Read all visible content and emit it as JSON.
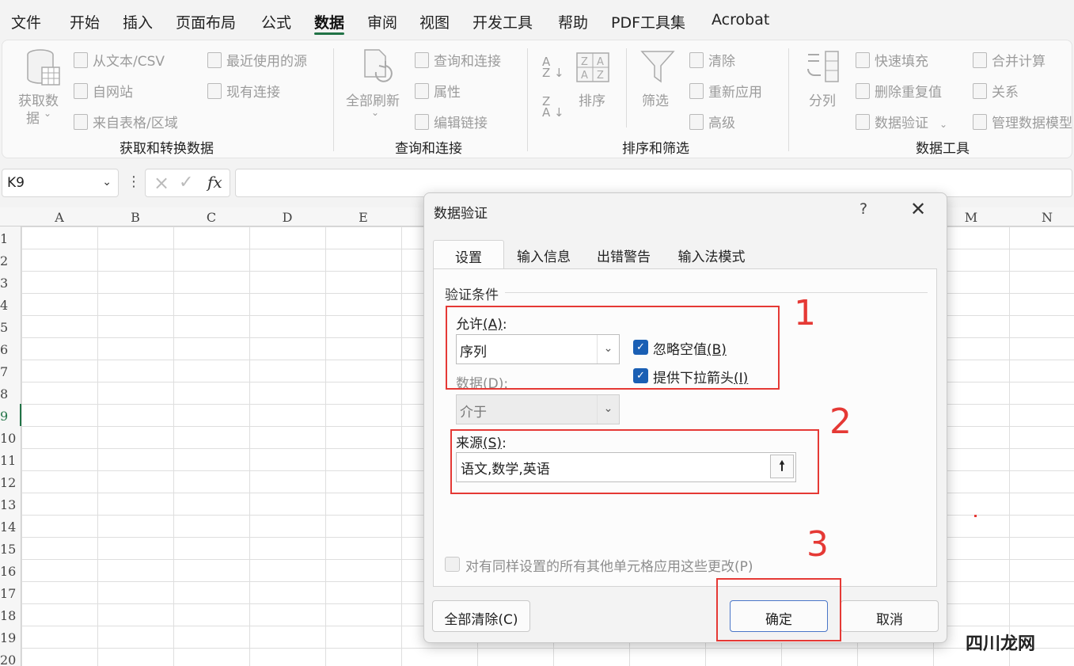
{
  "menu": {
    "tabs": [
      "文件",
      "开始",
      "插入",
      "页面布局",
      "公式",
      "数据",
      "审阅",
      "视图",
      "开发工具",
      "帮助",
      "PDF工具集",
      "Acrobat"
    ],
    "active": "数据"
  },
  "ribbon": {
    "get_data": "获取数",
    "get_data_2": "据",
    "from_text": "从文本/CSV",
    "from_web": "自网站",
    "from_table": "来自表格/区域",
    "recent_sources": "最近使用的源",
    "existing_conn": "现有连接",
    "group1": "获取和转换数据",
    "refresh_all": "全部刷新",
    "queries_conn": "查询和连接",
    "properties": "属性",
    "edit_links": "编辑链接",
    "group2": "查询和连接",
    "sort": "排序",
    "filter": "筛选",
    "clear": "清除",
    "reapply": "重新应用",
    "advanced": "高级",
    "group3": "排序和筛选",
    "text_to_columns": "分列",
    "flash_fill": "快速填充",
    "remove_dup": "删除重复值",
    "data_validation": "数据验证",
    "consolidate": "合并计算",
    "relationships": "关系",
    "manage_model": "管理数据模型",
    "group4": "数据工具"
  },
  "formula_bar": {
    "name_box": "K9",
    "fx": "fx",
    "formula": ""
  },
  "grid": {
    "columns_left": [
      "A",
      "B",
      "C",
      "D",
      "E"
    ],
    "columns_right": [
      "M",
      "N"
    ],
    "rows": [
      "1",
      "2",
      "3",
      "4",
      "5",
      "6",
      "7",
      "8",
      "9",
      "10",
      "11",
      "12",
      "13",
      "14",
      "15",
      "16",
      "17",
      "18",
      "19",
      "20"
    ],
    "selected_row": "9"
  },
  "dialog": {
    "title": "数据验证",
    "help": "?",
    "close": "✕",
    "tabs": [
      "设置",
      "输入信息",
      "出错警告",
      "输入法模式"
    ],
    "active_tab": "设置",
    "section": "验证条件",
    "allow_label": "允许",
    "allow_key": "(A)",
    "allow_colon": ":",
    "allow_value": "序列",
    "ignore_blank_label": "忽略空值",
    "ignore_blank_key": "(B)",
    "ignore_blank_checked": true,
    "dropdown_label": "提供下拉箭头",
    "dropdown_key": "(I)",
    "dropdown_checked": true,
    "data_label": "数据(D):",
    "data_value": "介于",
    "source_label": "来源",
    "source_key": "(S)",
    "source_colon": ":",
    "source_value": "语文,数学,英语",
    "apply_all_label": "对有同样设置的所有其他单元格应用这些更改(P)",
    "apply_all_checked": false,
    "clear_all": "全部清除(C)",
    "ok": "确定",
    "cancel": "取消"
  },
  "annotations": [
    "1",
    "2",
    "3"
  ],
  "watermark": "四川龙网"
}
